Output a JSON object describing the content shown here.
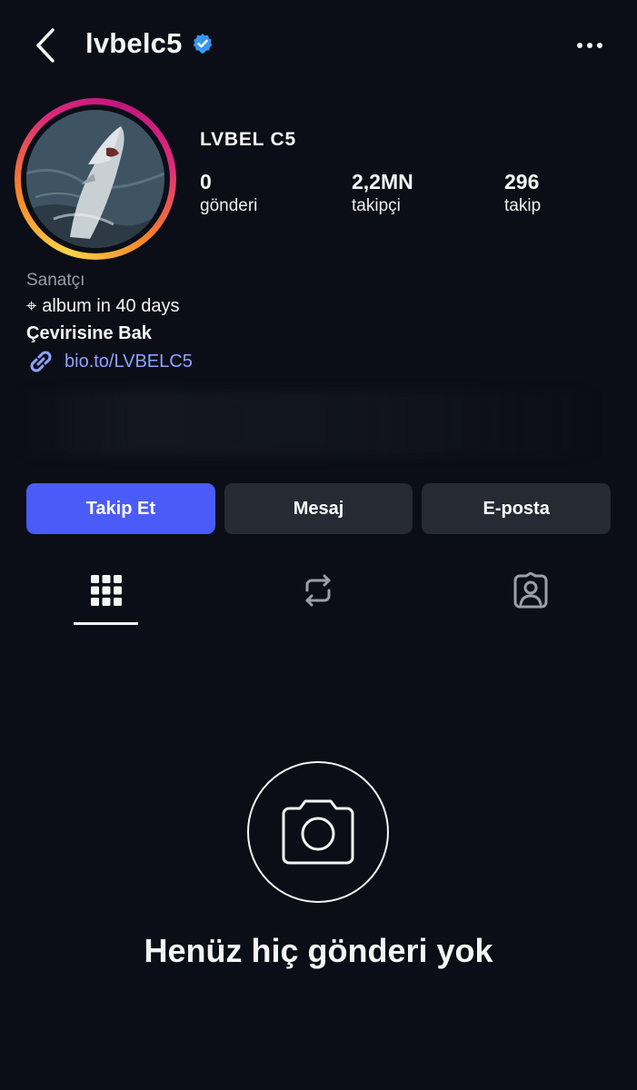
{
  "header": {
    "username": "lvbelc5",
    "verified_color": "#3897f0"
  },
  "profile": {
    "display_name": "LVBEL C5",
    "stats": [
      {
        "value": "0",
        "label": "gönderi"
      },
      {
        "value": "2,2MN",
        "label": "takipçi"
      },
      {
        "value": "296",
        "label": "takip"
      }
    ]
  },
  "bio": {
    "category": "Sanatçı",
    "line": "album in 40 days",
    "line_symbol": "⌖",
    "translate": "Çevirisine Bak",
    "link": "bio.to/LVBELC5"
  },
  "buttons": {
    "follow": "Takip Et",
    "message": "Mesaj",
    "email": "E-posta"
  },
  "tabs": [
    "grid-icon",
    "reposts-icon",
    "tagged-icon"
  ],
  "empty_state": {
    "title": "Henüz hiç gönderi yok"
  },
  "colors": {
    "background": "#0b0e16",
    "primary_button": "#4b5bf7",
    "secondary_button": "#252a33",
    "link": "#8ea3ff"
  }
}
